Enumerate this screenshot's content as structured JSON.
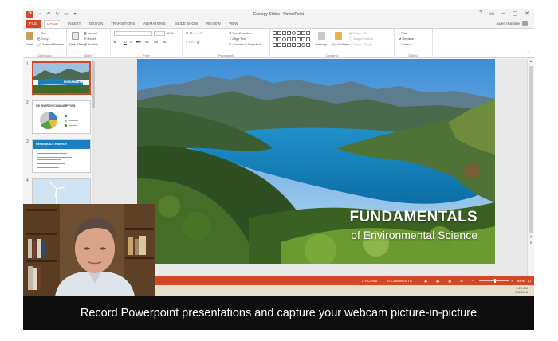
{
  "window": {
    "title": "Ecology Slides - PowerPoint",
    "app_icon_letter": "P",
    "controls": [
      "?",
      "▭",
      "–",
      "▢",
      "✕"
    ]
  },
  "quick_access": [
    "save-icon",
    "undo-icon",
    "redo-icon",
    "present-icon",
    "customize-icon"
  ],
  "tabs": {
    "file": "FILE",
    "items": [
      "HOME",
      "INSERT",
      "DESIGN",
      "TRANSITIONS",
      "ANIMATIONS",
      "SLIDE SHOW",
      "REVIEW",
      "VIEW"
    ],
    "user": "Aiden Hornsby"
  },
  "ribbon": {
    "clipboard": {
      "label": "Clipboard",
      "paste": "Paste",
      "cut": "Cut",
      "copy": "Copy",
      "format_painter": "Format Painter"
    },
    "slides": {
      "label": "Slides",
      "new_slide": "New Slide",
      "layout": "Layout",
      "reset": "Reset",
      "section": "Section"
    },
    "font": {
      "label": "Font",
      "bold": "B",
      "italic": "I",
      "underline": "U",
      "strike": "S",
      "shadow": "abc",
      "spacing": "AV",
      "case": "Aa",
      "color": "A"
    },
    "paragraph": {
      "label": "Paragraph",
      "text_direction": "Text Direction",
      "align_text": "Align Text",
      "convert_smartart": "Convert to SmartArt"
    },
    "drawing": {
      "label": "Drawing",
      "arrange": "Arrange",
      "quick_styles": "Quick Styles",
      "shape_fill": "Shape Fill",
      "shape_outline": "Shape Outline",
      "shape_effects": "Shape Effects"
    },
    "editing": {
      "label": "Editing",
      "find": "Find",
      "replace": "Replace",
      "select": "Select"
    }
  },
  "thumbnails": [
    {
      "num": "1",
      "title": "FUNDAMENTALS"
    },
    {
      "num": "2",
      "title": "US ENERGY CONSUMPTION"
    },
    {
      "num": "3",
      "title": "RENEWABLE ENERGY"
    },
    {
      "num": "4",
      "title": ""
    }
  ],
  "slide": {
    "title": "FUNDAMENTALS",
    "subtitle": "of Environmental Science"
  },
  "status": {
    "notes": "NOTES",
    "comments": "COMMENTS",
    "zoom": "69%"
  },
  "taskbar": {
    "time": "9:25 AM",
    "date": "5/5/2016"
  },
  "caption": {
    "text": "Record Powerpoint presentations and capture your webcam picture-in-picture"
  },
  "colors": {
    "accent": "#d24726",
    "caption_bg": "#0e0e0e"
  }
}
